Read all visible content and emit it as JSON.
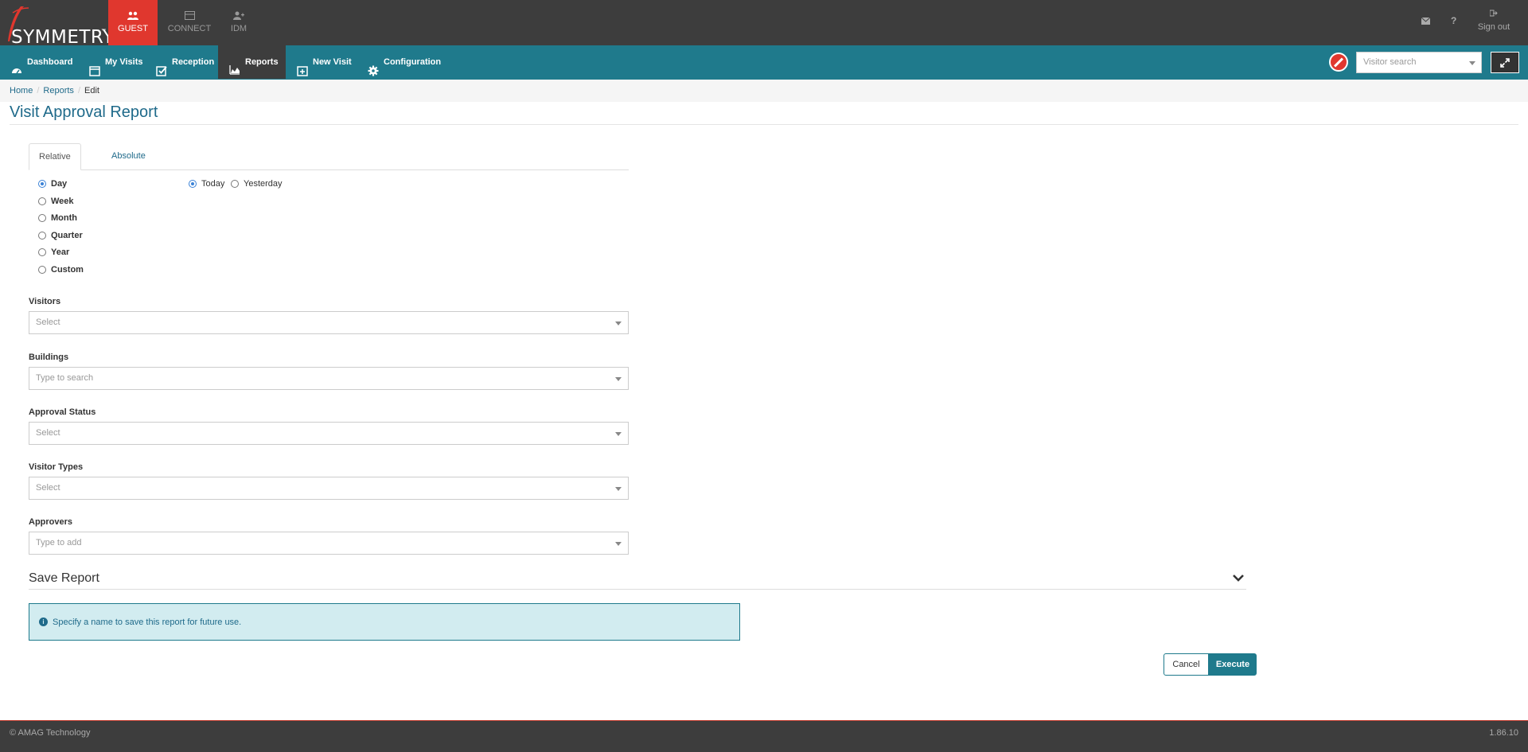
{
  "app": {
    "logo_text": "SYMMETRY",
    "logo_tm": "™",
    "modules": [
      {
        "label": "GUEST",
        "icon": "users-icon",
        "active": true
      },
      {
        "label": "CONNECT",
        "icon": "card-icon",
        "active": false
      },
      {
        "label": "IDM",
        "icon": "user-plus-icon",
        "active": false
      }
    ],
    "sign_out_label": "Sign out"
  },
  "nav": {
    "items": [
      {
        "label": "Dashboard",
        "icon": "dashboard-icon"
      },
      {
        "label": "My Visits",
        "icon": "calendar-icon"
      },
      {
        "label": "Reception",
        "icon": "check-square-icon"
      },
      {
        "label": "Reports",
        "icon": "area-chart-icon",
        "active": true
      },
      {
        "label": "New Visit",
        "icon": "calendar-plus-icon"
      },
      {
        "label": "Configuration",
        "icon": "gear-icon"
      }
    ],
    "visitor_search_placeholder": "Visitor search"
  },
  "breadcrumb": {
    "home": "Home",
    "reports": "Reports",
    "current": "Edit"
  },
  "page": {
    "title": "Visit Approval Report"
  },
  "tabs": {
    "relative": "Relative",
    "absolute": "Absolute"
  },
  "period": {
    "options": [
      "Day",
      "Week",
      "Month",
      "Quarter",
      "Year",
      "Custom"
    ],
    "selected": "Day",
    "day_options": [
      "Today",
      "Yesterday"
    ],
    "day_selected": "Today"
  },
  "fields": {
    "visitors": {
      "label": "Visitors",
      "placeholder": "Select"
    },
    "buildings": {
      "label": "Buildings",
      "placeholder": "Type to search"
    },
    "approval_status": {
      "label": "Approval Status",
      "placeholder": "Select"
    },
    "visitor_types": {
      "label": "Visitor Types",
      "placeholder": "Select"
    },
    "approvers": {
      "label": "Approvers",
      "placeholder": "Type to add"
    }
  },
  "save": {
    "title": "Save Report",
    "info": "Specify a name to save this report for future use."
  },
  "actions": {
    "cancel": "Cancel",
    "execute": "Execute"
  },
  "footer": {
    "copyright": "© AMAG Technology",
    "version": "1.86.10"
  },
  "colors": {
    "brand_teal": "#1f7a8c",
    "header_dark": "#3d3d3d",
    "guest_red": "#e0372e",
    "info_bg": "#d2ecf0"
  }
}
